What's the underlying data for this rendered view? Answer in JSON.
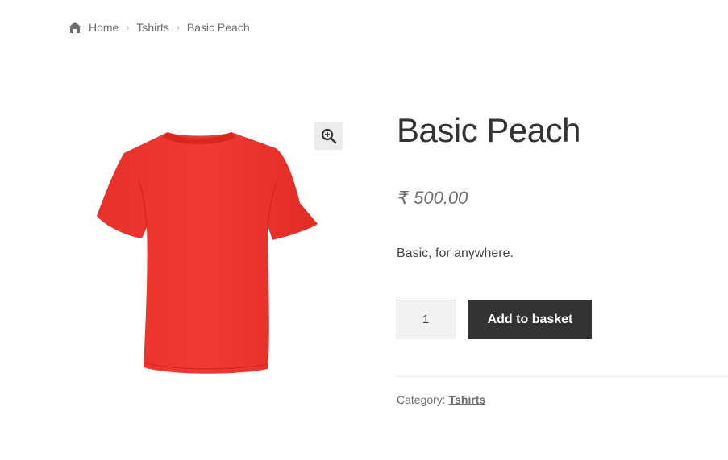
{
  "breadcrumb": {
    "home_icon": "home-icon",
    "items": [
      "Home",
      "Tshirts",
      "Basic Peach"
    ],
    "separator_icon": "chevron-right-icon"
  },
  "product": {
    "image_alt": "red t-shirt",
    "image_color": "#ee2e2a",
    "zoom_icon": "zoom-in-icon",
    "title": "Basic Peach",
    "price": "₹ 500.00",
    "short_description": "Basic, for anywhere.",
    "quantity": "1",
    "add_to_basket_label": "Add to basket",
    "category_label": "Category:",
    "category_value": "Tshirts"
  },
  "colors": {
    "button_bg": "#333333",
    "button_text": "#ffffff",
    "text": "#43454b",
    "muted": "#6d6d6d"
  }
}
